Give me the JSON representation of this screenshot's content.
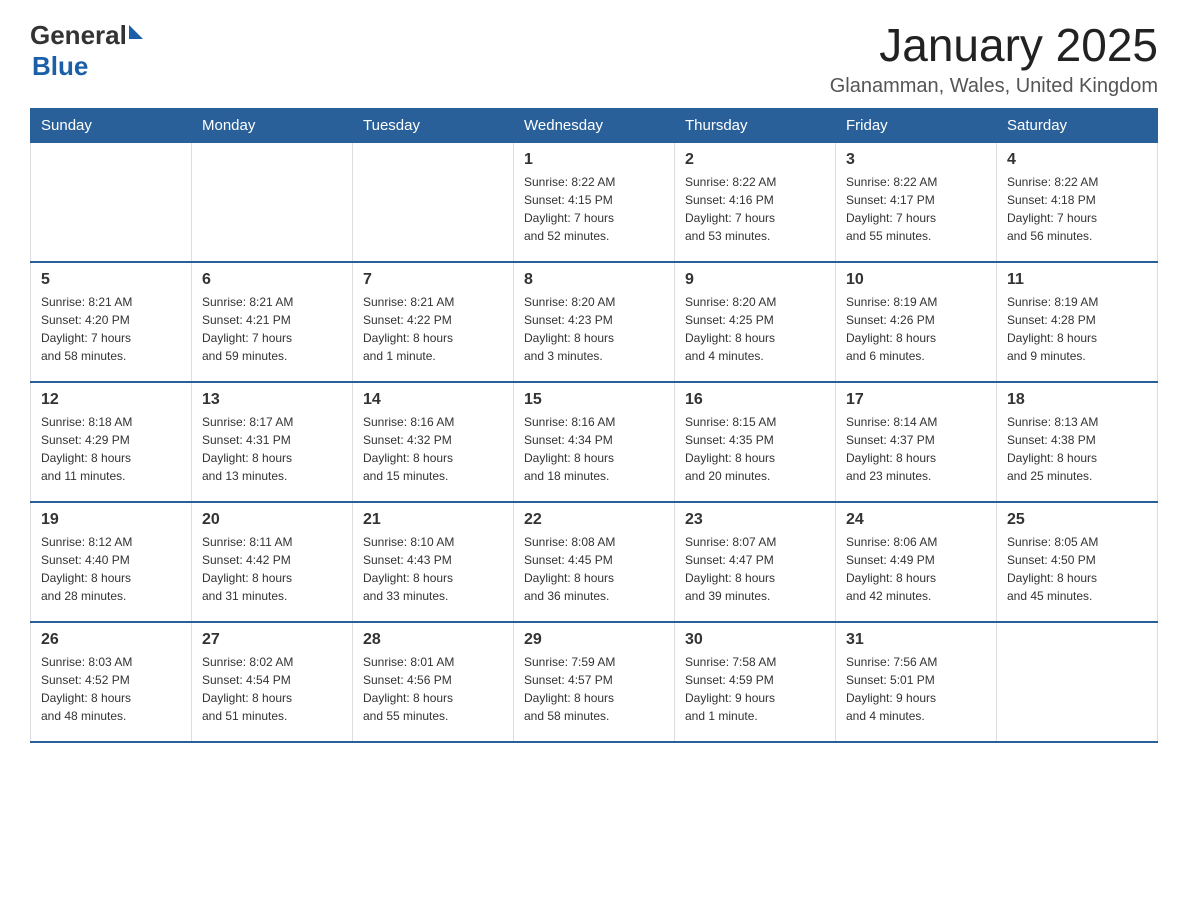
{
  "header": {
    "logo_general": "General",
    "logo_blue": "Blue",
    "month_title": "January 2025",
    "location": "Glanamman, Wales, United Kingdom"
  },
  "days_of_week": [
    "Sunday",
    "Monday",
    "Tuesday",
    "Wednesday",
    "Thursday",
    "Friday",
    "Saturday"
  ],
  "weeks": [
    [
      {
        "day": "",
        "info": ""
      },
      {
        "day": "",
        "info": ""
      },
      {
        "day": "",
        "info": ""
      },
      {
        "day": "1",
        "info": "Sunrise: 8:22 AM\nSunset: 4:15 PM\nDaylight: 7 hours\nand 52 minutes."
      },
      {
        "day": "2",
        "info": "Sunrise: 8:22 AM\nSunset: 4:16 PM\nDaylight: 7 hours\nand 53 minutes."
      },
      {
        "day": "3",
        "info": "Sunrise: 8:22 AM\nSunset: 4:17 PM\nDaylight: 7 hours\nand 55 minutes."
      },
      {
        "day": "4",
        "info": "Sunrise: 8:22 AM\nSunset: 4:18 PM\nDaylight: 7 hours\nand 56 minutes."
      }
    ],
    [
      {
        "day": "5",
        "info": "Sunrise: 8:21 AM\nSunset: 4:20 PM\nDaylight: 7 hours\nand 58 minutes."
      },
      {
        "day": "6",
        "info": "Sunrise: 8:21 AM\nSunset: 4:21 PM\nDaylight: 7 hours\nand 59 minutes."
      },
      {
        "day": "7",
        "info": "Sunrise: 8:21 AM\nSunset: 4:22 PM\nDaylight: 8 hours\nand 1 minute."
      },
      {
        "day": "8",
        "info": "Sunrise: 8:20 AM\nSunset: 4:23 PM\nDaylight: 8 hours\nand 3 minutes."
      },
      {
        "day": "9",
        "info": "Sunrise: 8:20 AM\nSunset: 4:25 PM\nDaylight: 8 hours\nand 4 minutes."
      },
      {
        "day": "10",
        "info": "Sunrise: 8:19 AM\nSunset: 4:26 PM\nDaylight: 8 hours\nand 6 minutes."
      },
      {
        "day": "11",
        "info": "Sunrise: 8:19 AM\nSunset: 4:28 PM\nDaylight: 8 hours\nand 9 minutes."
      }
    ],
    [
      {
        "day": "12",
        "info": "Sunrise: 8:18 AM\nSunset: 4:29 PM\nDaylight: 8 hours\nand 11 minutes."
      },
      {
        "day": "13",
        "info": "Sunrise: 8:17 AM\nSunset: 4:31 PM\nDaylight: 8 hours\nand 13 minutes."
      },
      {
        "day": "14",
        "info": "Sunrise: 8:16 AM\nSunset: 4:32 PM\nDaylight: 8 hours\nand 15 minutes."
      },
      {
        "day": "15",
        "info": "Sunrise: 8:16 AM\nSunset: 4:34 PM\nDaylight: 8 hours\nand 18 minutes."
      },
      {
        "day": "16",
        "info": "Sunrise: 8:15 AM\nSunset: 4:35 PM\nDaylight: 8 hours\nand 20 minutes."
      },
      {
        "day": "17",
        "info": "Sunrise: 8:14 AM\nSunset: 4:37 PM\nDaylight: 8 hours\nand 23 minutes."
      },
      {
        "day": "18",
        "info": "Sunrise: 8:13 AM\nSunset: 4:38 PM\nDaylight: 8 hours\nand 25 minutes."
      }
    ],
    [
      {
        "day": "19",
        "info": "Sunrise: 8:12 AM\nSunset: 4:40 PM\nDaylight: 8 hours\nand 28 minutes."
      },
      {
        "day": "20",
        "info": "Sunrise: 8:11 AM\nSunset: 4:42 PM\nDaylight: 8 hours\nand 31 minutes."
      },
      {
        "day": "21",
        "info": "Sunrise: 8:10 AM\nSunset: 4:43 PM\nDaylight: 8 hours\nand 33 minutes."
      },
      {
        "day": "22",
        "info": "Sunrise: 8:08 AM\nSunset: 4:45 PM\nDaylight: 8 hours\nand 36 minutes."
      },
      {
        "day": "23",
        "info": "Sunrise: 8:07 AM\nSunset: 4:47 PM\nDaylight: 8 hours\nand 39 minutes."
      },
      {
        "day": "24",
        "info": "Sunrise: 8:06 AM\nSunset: 4:49 PM\nDaylight: 8 hours\nand 42 minutes."
      },
      {
        "day": "25",
        "info": "Sunrise: 8:05 AM\nSunset: 4:50 PM\nDaylight: 8 hours\nand 45 minutes."
      }
    ],
    [
      {
        "day": "26",
        "info": "Sunrise: 8:03 AM\nSunset: 4:52 PM\nDaylight: 8 hours\nand 48 minutes."
      },
      {
        "day": "27",
        "info": "Sunrise: 8:02 AM\nSunset: 4:54 PM\nDaylight: 8 hours\nand 51 minutes."
      },
      {
        "day": "28",
        "info": "Sunrise: 8:01 AM\nSunset: 4:56 PM\nDaylight: 8 hours\nand 55 minutes."
      },
      {
        "day": "29",
        "info": "Sunrise: 7:59 AM\nSunset: 4:57 PM\nDaylight: 8 hours\nand 58 minutes."
      },
      {
        "day": "30",
        "info": "Sunrise: 7:58 AM\nSunset: 4:59 PM\nDaylight: 9 hours\nand 1 minute."
      },
      {
        "day": "31",
        "info": "Sunrise: 7:56 AM\nSunset: 5:01 PM\nDaylight: 9 hours\nand 4 minutes."
      },
      {
        "day": "",
        "info": ""
      }
    ]
  ],
  "colors": {
    "header_bg": "#2a6099",
    "header_text": "#ffffff",
    "border": "#2a6099"
  }
}
